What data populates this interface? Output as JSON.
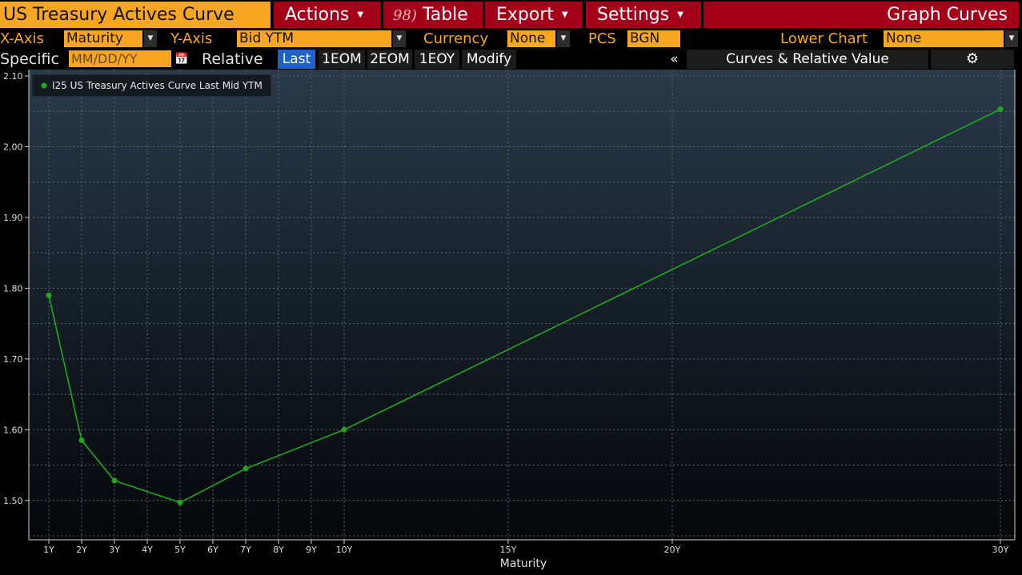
{
  "toolbar": {
    "title": "US Treasury Actives Curve",
    "actions_label": "Actions",
    "table_number": "98)",
    "table_label": "Table",
    "export_label": "Export",
    "settings_label": "Settings",
    "graph_curves_label": "Graph Curves"
  },
  "options": {
    "x_axis_label": "X-Axis",
    "x_axis_value": "Maturity",
    "y_axis_label": "Y-Axis",
    "y_axis_value": "Bid YTM",
    "currency_label": "Currency",
    "currency_value": "None",
    "pcs_label": "PCS",
    "pcs_value": "BGN",
    "lower_chart_label": "Lower Chart",
    "lower_chart_value": "None"
  },
  "dates": {
    "specific_label": "Specific",
    "date_placeholder": "MM/DD/YY",
    "relative_label": "Relative",
    "buttons": [
      "Last",
      "1EOM",
      "2EOM",
      "1EOY",
      "Modify"
    ],
    "selected": "Last",
    "collapse_glyph": "«",
    "panel_title": "Curves & Relative Value"
  },
  "colors": {
    "accent_orange": "#f6a623",
    "menu_red": "#a4001a",
    "series_green": "#1fa81f",
    "selected_blue": "#1e62c8"
  },
  "chart_data": {
    "type": "line",
    "xlabel": "Maturity",
    "ylabel": "",
    "x_tick_labels": [
      "1Y",
      "2Y",
      "3Y",
      "4Y",
      "5Y",
      "6Y",
      "7Y",
      "8Y",
      "9Y",
      "10Y",
      "15Y",
      "20Y",
      "30Y"
    ],
    "x_tick_years": [
      1,
      2,
      3,
      4,
      5,
      6,
      7,
      8,
      9,
      10,
      15,
      20,
      30
    ],
    "y_ticks": [
      1.5,
      1.6,
      1.7,
      1.8,
      1.9,
      2.0,
      2.1
    ],
    "y_tick_labels": [
      "1.50",
      "1.60",
      "1.70",
      "1.80",
      "1.90",
      "2.00",
      "2.10"
    ],
    "ylim": [
      1.45,
      2.1
    ],
    "grid": true,
    "legend_position": "top-left",
    "series": [
      {
        "name": "I25 US Treasury Actives Curve Last Mid YTM",
        "x": [
          1,
          2,
          3,
          5,
          7,
          10,
          30
        ],
        "y": [
          1.79,
          1.585,
          1.528,
          1.497,
          1.545,
          1.6,
          2.053
        ]
      }
    ]
  }
}
